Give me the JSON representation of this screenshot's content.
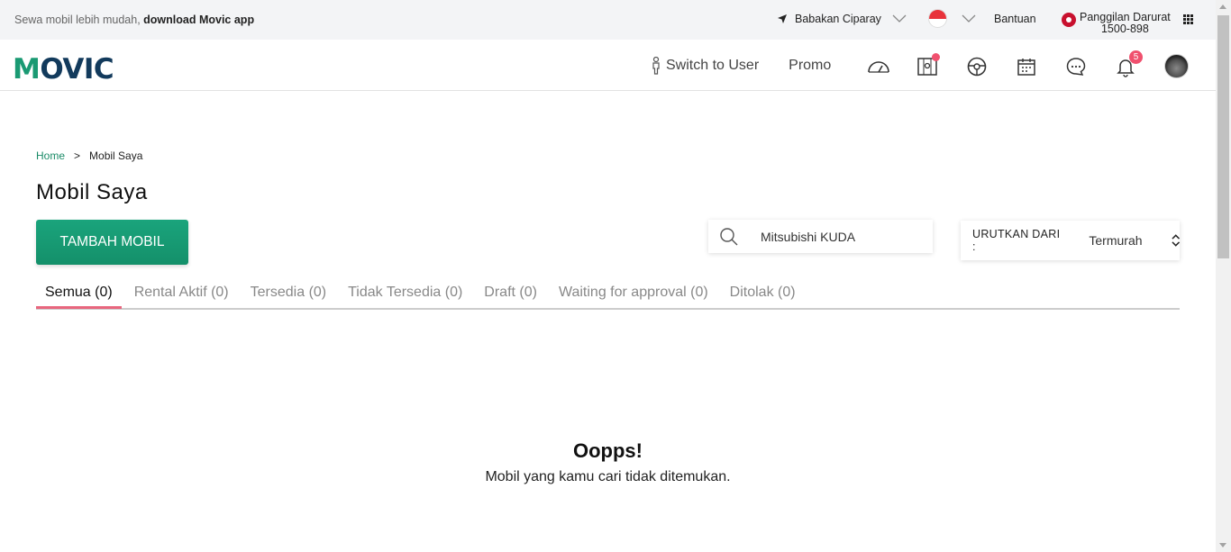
{
  "topbar": {
    "promo_text": "Sewa mobil lebih mudah,",
    "promo_link": "download Movic app",
    "location": "Babakan Ciparay",
    "help": "Bantuan",
    "emergency_label": "Panggilan Darurat",
    "emergency_number": "1500-898"
  },
  "header": {
    "logo": "MOVIC",
    "switch_user": "Switch to User",
    "promo": "Promo",
    "notification_count": "5"
  },
  "breadcrumb": {
    "home": "Home",
    "separator": ">",
    "current": "Mobil Saya"
  },
  "page_title": "Mobil Saya",
  "add_button": "TAMBAH MOBIL",
  "search": {
    "value": "Mitsubishi KUDA"
  },
  "sort": {
    "label": "URUTKAN DARI :",
    "value": "Termurah"
  },
  "tabs": [
    {
      "label": "Semua (0)"
    },
    {
      "label": "Rental Aktif (0)"
    },
    {
      "label": "Tersedia (0)"
    },
    {
      "label": "Tidak Tersedia (0)"
    },
    {
      "label": "Draft (0)"
    },
    {
      "label": "Waiting for approval (0)"
    },
    {
      "label": "Ditolak (0)"
    }
  ],
  "empty_state": {
    "title": "Oopps!",
    "message": "Mobil yang kamu cari tidak ditemukan."
  },
  "colors": {
    "brand_green": "#1a9a73",
    "brand_navy": "#123a5c",
    "accent_pink": "#e8667e",
    "badge": "#f0506e"
  }
}
